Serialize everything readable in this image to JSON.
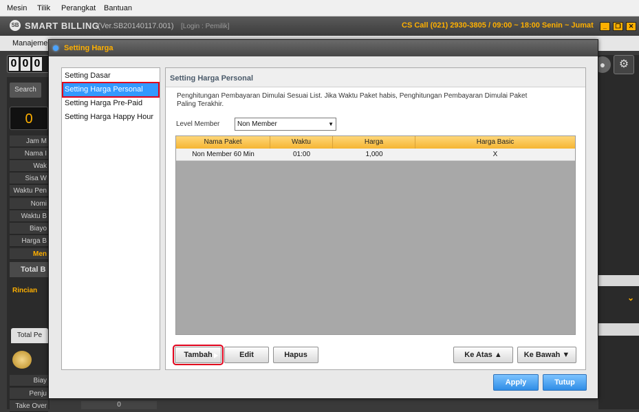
{
  "menubar": {
    "items": [
      "Mesin",
      "Tilik",
      "Perangkat",
      "Bantuan"
    ]
  },
  "app": {
    "logo_text": "SB",
    "name": "SMART BILLING",
    "version": "(Ver.SB20140117.001)",
    "login": "[Login : Pemilik]",
    "cs_call": "CS Call (021) 2930-3805 / 09:00 ~ 18:00 Senin ~ Jumat",
    "accent_color": "#ffb000"
  },
  "background": {
    "toolbar_item": "Manajeme",
    "counter_digits": [
      "0",
      "0",
      "0"
    ],
    "search_tab": "Search",
    "big_value": "0",
    "rows": [
      "Jam M",
      "Nama I",
      "Wak",
      "Sisa W",
      "Waktu Pen",
      "Nomi",
      "Waktu B",
      "Biayo",
      "Harga B",
      "Men"
    ],
    "total_label": "Total B",
    "rincian_label": "Rincian",
    "total_pe_tab": "Total Pe",
    "bottom_rows": [
      "Biay",
      "Penju",
      "Take Over"
    ],
    "take_over_value": "0"
  },
  "dialog": {
    "title": "Setting Harga",
    "nav": [
      {
        "label": "Setting Dasar",
        "active": false
      },
      {
        "label": "Setting Harga Personal",
        "active": true
      },
      {
        "label": "Setting Harga Pre-Paid",
        "active": false
      },
      {
        "label": "Setting Harga Happy Hour",
        "active": false
      }
    ],
    "panel_title": "Setting Harga Personal",
    "description_line1": "Penghitungan Pembayaran Dimulai Sesuai List. Jika Waktu Paket habis, Penghitungan Pembayaran Dimulai Paket",
    "description_line2": "Paling Terakhir.",
    "level_label": "Level Member",
    "level_value": "Non Member",
    "grid": {
      "headers": [
        "Nama Paket",
        "Waktu",
        "Harga",
        "Harga Basic"
      ],
      "rows": [
        [
          "Non Member 60 Min",
          "01:00",
          "1,000",
          "X"
        ]
      ]
    },
    "buttons": {
      "tambah": "Tambah",
      "edit": "Edit",
      "hapus": "Hapus",
      "ke_atas": "Ke Atas ▲",
      "ke_bawah": "Ke Bawah ▼",
      "apply": "Apply",
      "tutup": "Tutup"
    }
  }
}
